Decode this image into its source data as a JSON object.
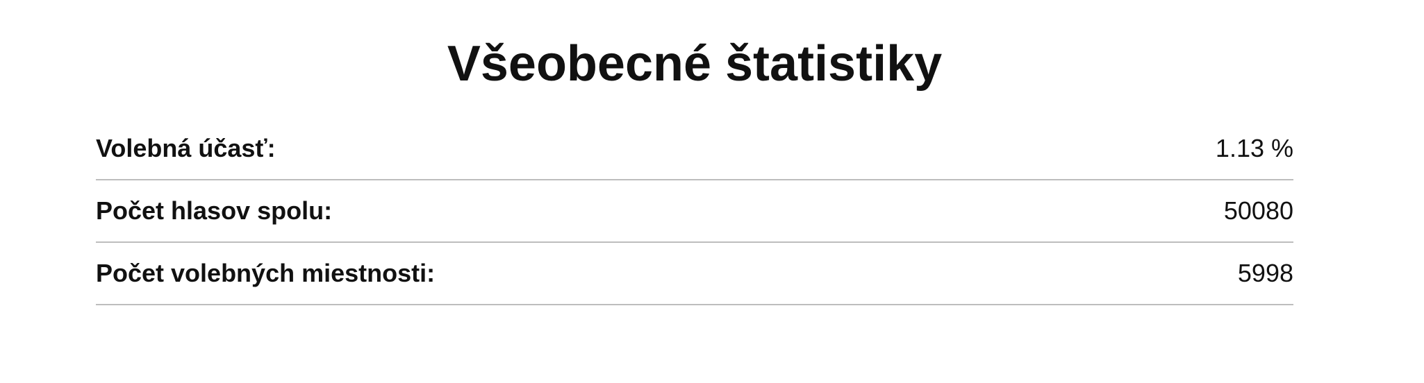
{
  "general_stats": {
    "title": "Všeobecné štatistiky",
    "rows": [
      {
        "label": "Volebná účasť:",
        "value": "1.13 %"
      },
      {
        "label": "Počet hlasov spolu:",
        "value": "50080"
      },
      {
        "label": "Počet volebných miestnosti:",
        "value": "5998"
      }
    ]
  }
}
